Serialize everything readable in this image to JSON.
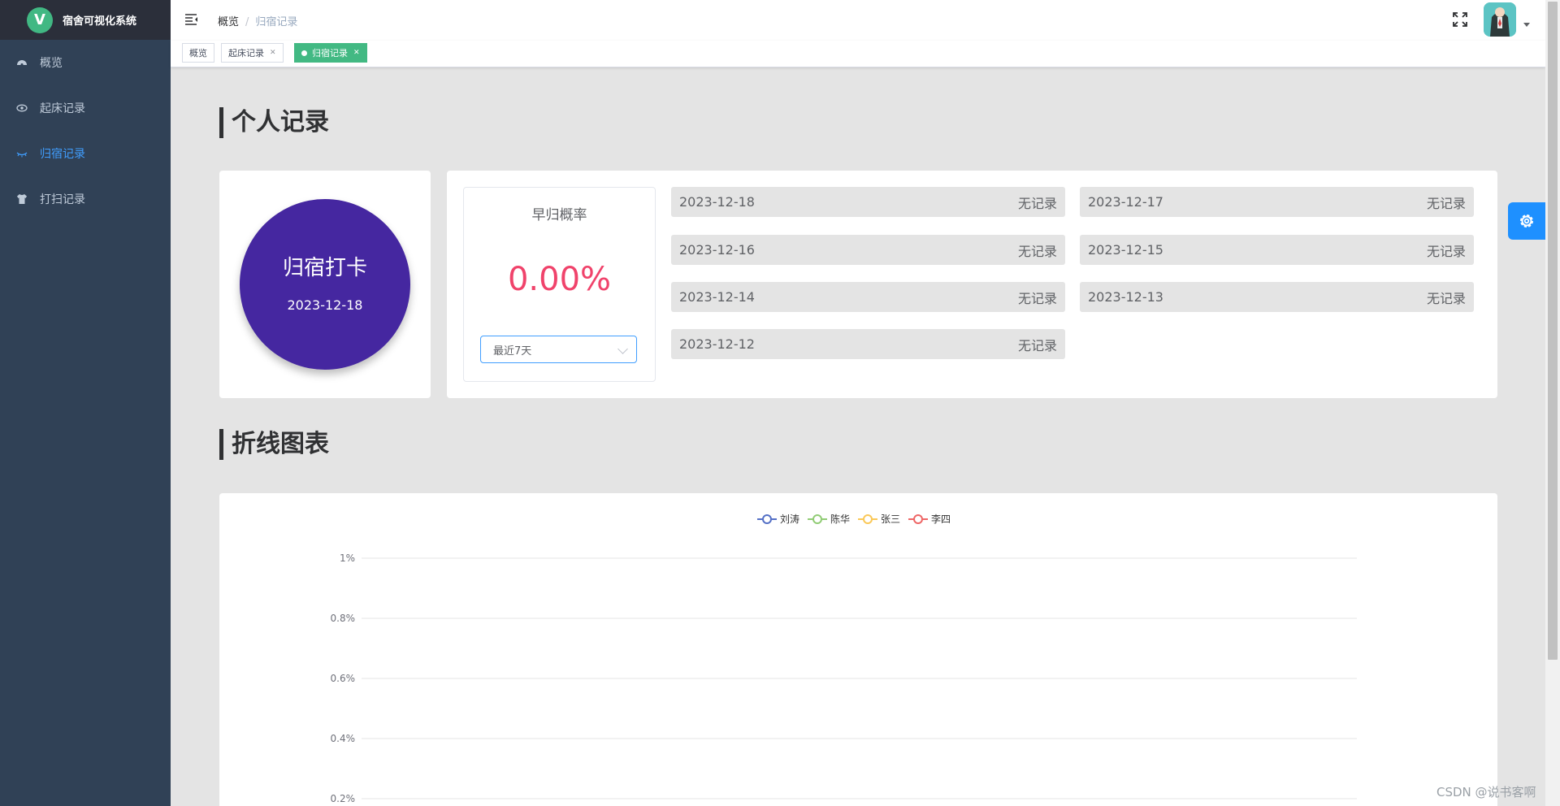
{
  "app": {
    "title": "宿舍可视化系统",
    "logo_letter": "V"
  },
  "sidebar": {
    "items": [
      {
        "label": "概览",
        "icon": "dashboard-icon"
      },
      {
        "label": "起床记录",
        "icon": "eye-icon"
      },
      {
        "label": "归宿记录",
        "icon": "eye-closed-icon",
        "active": true
      },
      {
        "label": "打扫记录",
        "icon": "shirt-icon"
      }
    ]
  },
  "header": {
    "breadcrumb": [
      "概览",
      "归宿记录"
    ],
    "separator": "/"
  },
  "tags": [
    {
      "label": "概览"
    },
    {
      "label": "起床记录",
      "closable": true
    },
    {
      "label": "归宿记录",
      "closable": true,
      "active": true
    }
  ],
  "personal": {
    "title": "个人记录",
    "punch": {
      "label": "归宿打卡",
      "date": "2023-12-18"
    },
    "rate": {
      "title": "早归概率",
      "value": "0.00%",
      "range_selected": "最近7天"
    },
    "records": [
      {
        "date": "2023-12-18",
        "status": "无记录"
      },
      {
        "date": "2023-12-17",
        "status": "无记录"
      },
      {
        "date": "2023-12-16",
        "status": "无记录"
      },
      {
        "date": "2023-12-15",
        "status": "无记录"
      },
      {
        "date": "2023-12-14",
        "status": "无记录"
      },
      {
        "date": "2023-12-13",
        "status": "无记录"
      },
      {
        "date": "2023-12-12",
        "status": "无记录"
      }
    ]
  },
  "chart_section": {
    "title": "折线图表"
  },
  "chart_data": {
    "type": "line",
    "series": [
      {
        "name": "刘涛",
        "color": "#5470c6",
        "values": []
      },
      {
        "name": "陈华",
        "color": "#91cc75",
        "values": []
      },
      {
        "name": "张三",
        "color": "#fac858",
        "values": []
      },
      {
        "name": "李四",
        "color": "#ee6666",
        "values": []
      }
    ],
    "yticks": [
      "1%",
      "0.8%",
      "0.6%",
      "0.4%",
      "0.2%"
    ],
    "ylim": [
      0,
      1
    ],
    "grid": true,
    "legend": "top-center"
  },
  "watermark": "CSDN @说书客啊",
  "colors": {
    "sidebar_bg": "#304156",
    "accent": "#409eff",
    "tag_active": "#42b983",
    "punch": "#4527a0",
    "rate": "#f0436b"
  }
}
